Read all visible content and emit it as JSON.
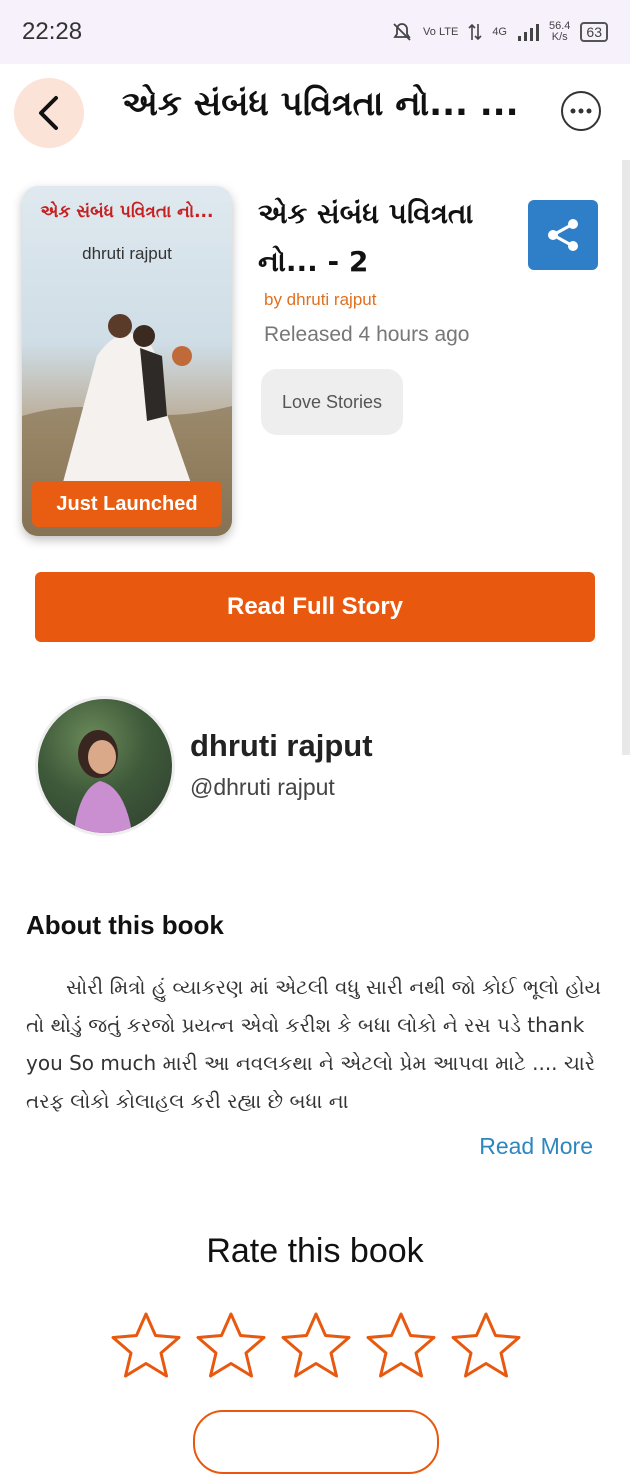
{
  "status_bar": {
    "time": "22:28",
    "network": "Vo LTE",
    "signal": "4G",
    "speed": "56.4",
    "speed_unit": "K/s",
    "battery": "63"
  },
  "app_bar": {
    "title": "એક સંબંધ પવિત્રતા નો... ...",
    "back_icon": "chevron-left-icon",
    "more_icon": "ellipsis-icon"
  },
  "book": {
    "cover_title": "એક સંબંધ પવિત્રતા નો...",
    "cover_author": "dhruti rajput",
    "badge": "Just Launched",
    "title_line1": "એક સંબંધ પવિત્રતા",
    "title_line2": "નો... - 2",
    "author_line": "by dhruti rajput",
    "released": "Released 4 hours ago",
    "genre": "Love Stories",
    "share_icon": "share-icon"
  },
  "actions": {
    "read_full": "Read Full Story"
  },
  "author": {
    "name": "dhruti rajput",
    "handle": "@dhruti rajput"
  },
  "about": {
    "heading": "About this book",
    "text": "સોરી મિત્રો હું વ્યાકરણ માં એટલી વધુ સારી નથી જો કોઈ ભૂલો હોય તો થોડું જતું કરજો પ્રયત્ન એવો કરીશ કે બધા લોકો ને રસ પડે thank you So much મારી આ નવલકથા ને એટલો પ્રેમ આપવા માટે ....      ચારે તરફ લોકો કોલાહલ કરી રહ્યા છે બધા ના",
    "read_more": "Read More"
  },
  "rating": {
    "heading": "Rate this book",
    "stars_filled": 0,
    "stars_total": 5,
    "star_color": "#e8590f"
  },
  "colors": {
    "accent": "#e8590f",
    "share_blue": "#2f7fc8",
    "link_blue": "#2e86c1"
  }
}
